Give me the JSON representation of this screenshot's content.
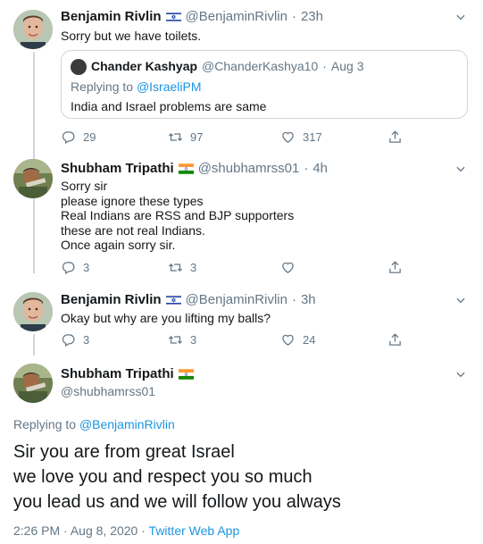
{
  "tweet1": {
    "name": "Benjamin Rivlin",
    "handle": "@BenjaminRivlin",
    "sep": "·",
    "time": "23h",
    "text": "Sorry but we have toilets.",
    "quote": {
      "name": "Chander Kashyap",
      "handle": "@ChanderKashya10",
      "sep": "·",
      "time": "Aug 3",
      "replying_label": "Replying to",
      "replying_handle": "@IsraeliPM",
      "text": "India and Israel problems are same"
    },
    "replies": "29",
    "retweets": "97",
    "likes": "317"
  },
  "tweet2": {
    "name": "Shubham Tripathi",
    "handle": "@shubhamrss01",
    "sep": "·",
    "time": "4h",
    "lines": [
      "Sorry sir",
      "please ignore these types",
      "Real Indians are RSS and BJP supporters",
      "these are not real Indians.",
      "Once again sorry sir."
    ],
    "replies": "3",
    "retweets": "3"
  },
  "tweet3": {
    "name": "Benjamin Rivlin",
    "handle": "@BenjaminRivlin",
    "sep": "·",
    "time": "3h",
    "text": "Okay but why are you lifting my balls?",
    "replies": "3",
    "retweets": "3",
    "likes": "24"
  },
  "main": {
    "name": "Shubham Tripathi",
    "handle": "@shubhamrss01",
    "replying_label": "Replying to",
    "replying_handle": "@BenjaminRivlin",
    "lines": [
      "Sir you are from great Israel",
      "we love you and respect you so much",
      "you lead us and we will follow you always"
    ],
    "time": "2:26 PM",
    "date": "Aug 8, 2020",
    "sep": "·",
    "client": "Twitter Web App"
  },
  "colors": {
    "link": "#1b95e0",
    "muted": "#657786",
    "text": "#14171a",
    "thread_line": "#cdd6dd"
  },
  "icons": [
    "reply-icon",
    "retweet-icon",
    "like-icon",
    "share-icon",
    "chevron-down-icon",
    "israel-flag-icon",
    "india-flag-icon"
  ]
}
